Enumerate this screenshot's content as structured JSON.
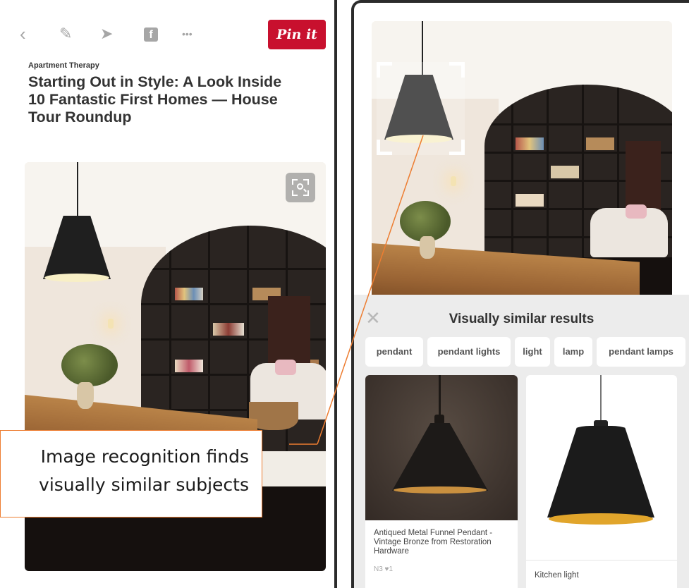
{
  "left_phone": {
    "toolbar": {
      "back_icon": "chevron-left-icon",
      "edit_icon": "pencil-icon",
      "send_icon": "send-icon",
      "facebook_glyph": "f",
      "more_icon": "•••",
      "pin_it_label": "Pin it"
    },
    "source": "Apartment Therapy",
    "title": "Starting Out in Style: A Look Inside 10 Fantastic First Homes — House Tour Roundup",
    "visual_search_icon": "visual-search-icon"
  },
  "right_phone": {
    "results": {
      "close_glyph": "✕",
      "title": "Visually similar results",
      "chips": [
        "pendant",
        "pendant lights",
        "light",
        "lamp",
        "pendant lamps"
      ],
      "cards": [
        {
          "description": "Antiqued Metal Funnel Pendant - Vintage Bronze from Restoration Hardware",
          "stats": "N3 ♥1"
        },
        {
          "description": "Kitchen light"
        }
      ]
    }
  },
  "annotation": {
    "line1": "Image recognition finds",
    "line2": "visually similar subjects"
  },
  "colors": {
    "pin_red": "#c8102e",
    "callout_orange": "#ed7d31",
    "panel_gray": "#ececec"
  }
}
